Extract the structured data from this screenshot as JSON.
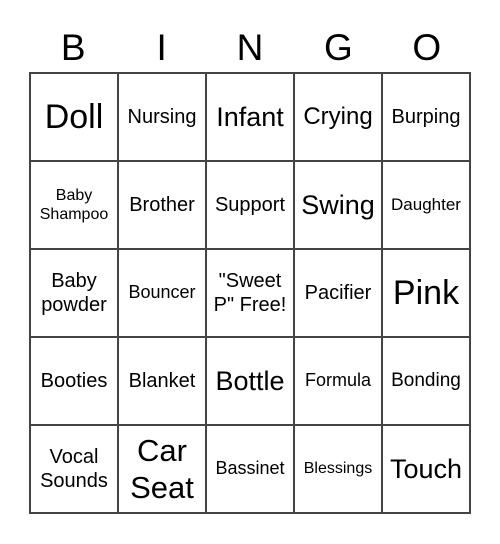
{
  "header": [
    "B",
    "I",
    "N",
    "G",
    "O"
  ],
  "cells": [
    {
      "text": "Doll",
      "size": 34
    },
    {
      "text": "Nursing",
      "size": 20
    },
    {
      "text": "Infant",
      "size": 27
    },
    {
      "text": "Crying",
      "size": 24
    },
    {
      "text": "Burping",
      "size": 20
    },
    {
      "text": "Baby Shampoo",
      "size": 16
    },
    {
      "text": "Brother",
      "size": 20
    },
    {
      "text": "Support",
      "size": 20
    },
    {
      "text": "Swing",
      "size": 27
    },
    {
      "text": "Daughter",
      "size": 17
    },
    {
      "text": "Baby powder",
      "size": 20
    },
    {
      "text": "Bouncer",
      "size": 18
    },
    {
      "text": "\"Sweet P\" Free!",
      "size": 20
    },
    {
      "text": "Pacifier",
      "size": 20
    },
    {
      "text": "Pink",
      "size": 34
    },
    {
      "text": "Booties",
      "size": 20
    },
    {
      "text": "Blanket",
      "size": 20
    },
    {
      "text": "Bottle",
      "size": 27
    },
    {
      "text": "Formula",
      "size": 18
    },
    {
      "text": "Bonding",
      "size": 19
    },
    {
      "text": "Vocal Sounds",
      "size": 20
    },
    {
      "text": "Car Seat",
      "size": 31
    },
    {
      "text": "Bassinet",
      "size": 18
    },
    {
      "text": "Blessings",
      "size": 16
    },
    {
      "text": "Touch",
      "size": 27
    }
  ]
}
